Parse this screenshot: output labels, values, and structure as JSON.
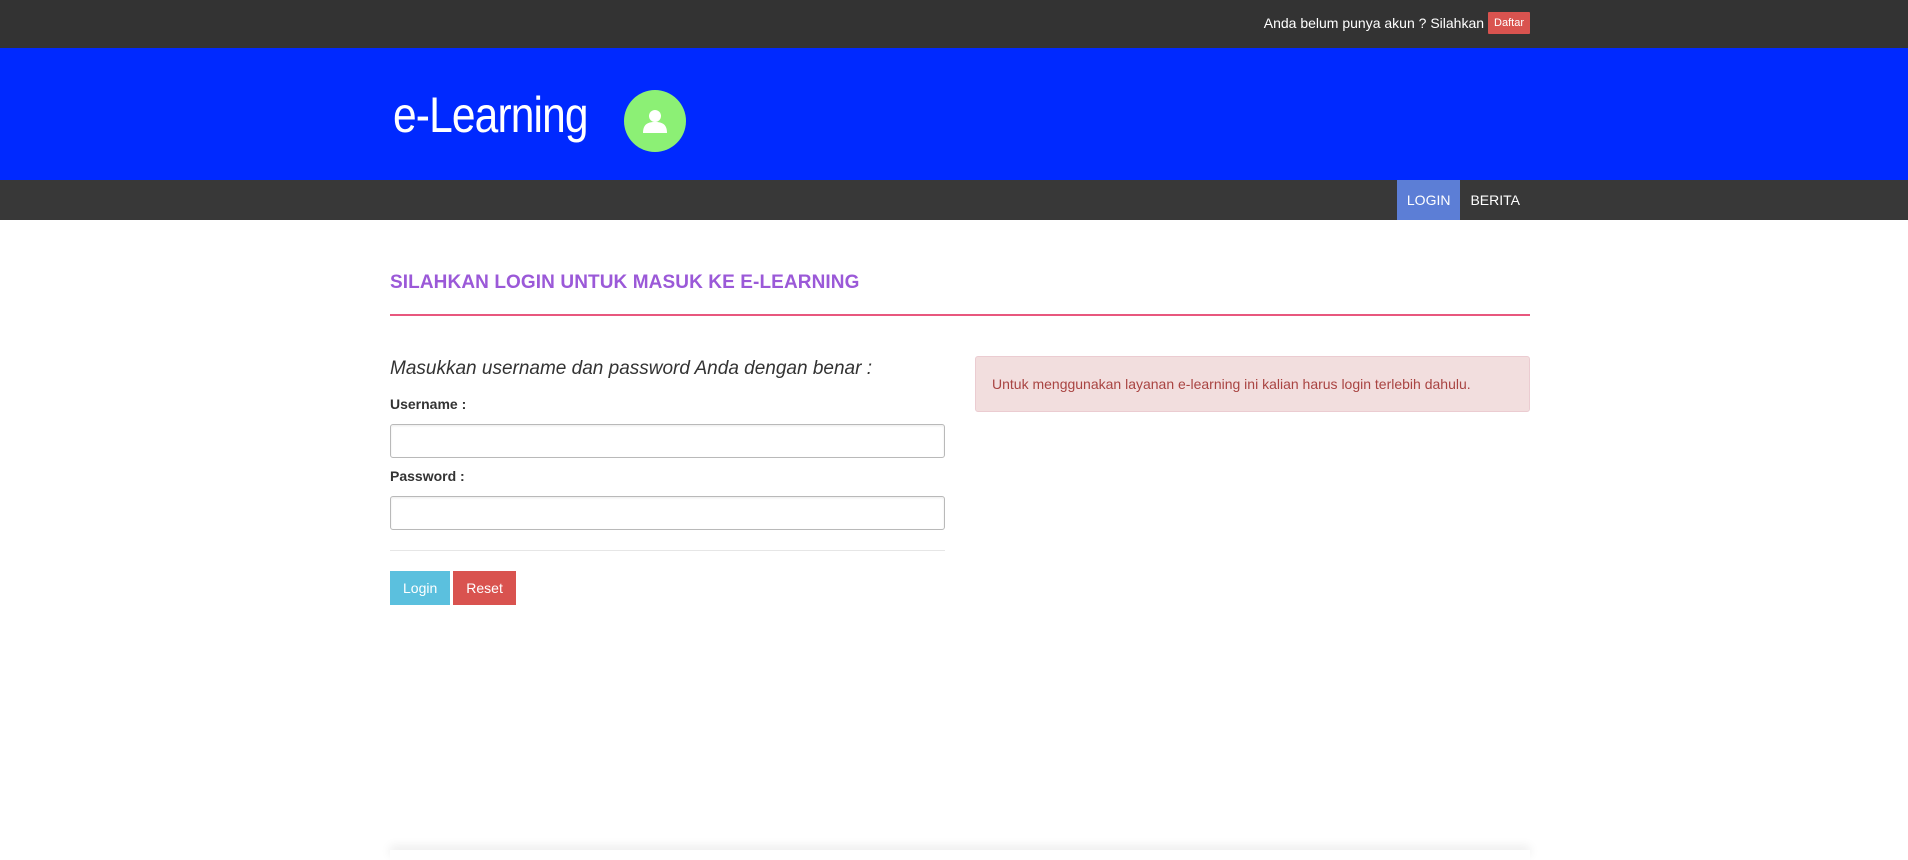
{
  "topbar": {
    "prompt": "Anda belum punya akun ? Silahkan",
    "register_label": "Daftar"
  },
  "header": {
    "brand": "e-Learning",
    "avatar_icon": "user-icon"
  },
  "navbar": {
    "items": [
      {
        "label": "LOGIN",
        "active": true
      },
      {
        "label": "BERITA",
        "active": false
      }
    ]
  },
  "main": {
    "title": "SILAHKAN LOGIN UNTUK MASUK KE E-LEARNING",
    "instruction": "Masukkan username dan password Anda dengan benar :",
    "username_label": "Username :",
    "username_value": "",
    "password_label": "Password :",
    "password_value": "",
    "login_label": "Login",
    "reset_label": "Reset",
    "alert": "Untuk menggunakan layanan e-learning ini kalian harus login terlebih dahulu."
  },
  "colors": {
    "topbar": "#333333",
    "header": "#0029ff",
    "navbar": "#383838",
    "nav_active": "#5c7ed6",
    "title": "#9b59d8",
    "rule": "#e8577e",
    "login_button": "#5bc0de",
    "reset_button": "#d9534f",
    "alert_bg": "#f2dede",
    "alert_text": "#a94442"
  }
}
